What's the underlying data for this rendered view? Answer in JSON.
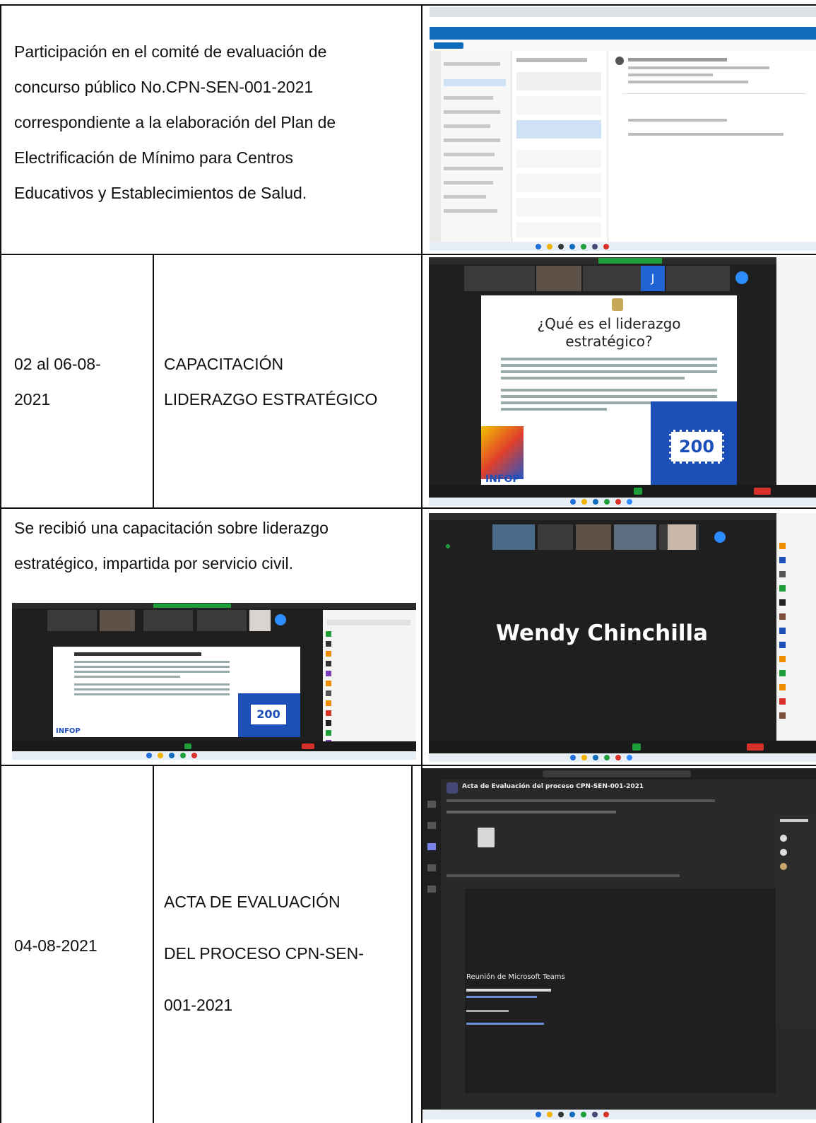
{
  "rows": [
    {
      "text": "Participación en el comité de evaluación de concurso público No.CPN-SEN-001-2021 correspondiente a la elaboración del Plan de Electrificación de Mínimo para Centros Educativos y Establecimientos de Salud.",
      "lines": [
        "Participación en el comité de evaluación de",
        "concurso público No.CPN-SEN-001-2021",
        "correspondiente a la elaboración del Plan de",
        "Electrificación de Mínimo para Centros",
        "Educativos y Establecimientos de Salud."
      ]
    },
    {
      "date_lines": [
        "02 al 06-08-",
        "2021"
      ],
      "activity_lines": [
        "CAPACITACIÓN",
        "LIDERAZGO ESTRATÉGICO"
      ],
      "screenshot": {
        "slide_title_lines": [
          "¿Qué es el liderazgo",
          "estratégico?"
        ],
        "participant_initial": "J",
        "slide_logo": "INFOP",
        "badge_number": "200"
      }
    },
    {
      "lines": [
        "Se recibió una capacitación sobre liderazgo",
        "estratégico, impartida por servicio civil."
      ],
      "screenshot_big_name": "Wendy Chinchilla",
      "inner_slide_logo": "INFOP",
      "inner_badge_number": "200"
    },
    {
      "date": "04-08-2021",
      "activity_lines": [
        "ACTA DE EVALUACIÓN",
        "DEL PROCESO CPN-SEN-",
        "001-2021"
      ],
      "screenshot": {
        "title": "Acta de Evaluación del proceso CPN-SEN-001-2021",
        "heading": "Reunión de Microsoft Teams"
      }
    }
  ],
  "colors": {
    "border": "#111111",
    "zoom_dark": "#1f1f1f",
    "outlook_blue": "#0f6cbd",
    "teams_purple": "#464775",
    "windows_taskbar": "#e8eef6",
    "zoom_green": "#1e9e3a",
    "zoom_red": "#d6312b"
  },
  "icons": [
    "outlook-screenshot-icon",
    "zoom-screenshot-icon",
    "teams-screenshot-icon"
  ]
}
